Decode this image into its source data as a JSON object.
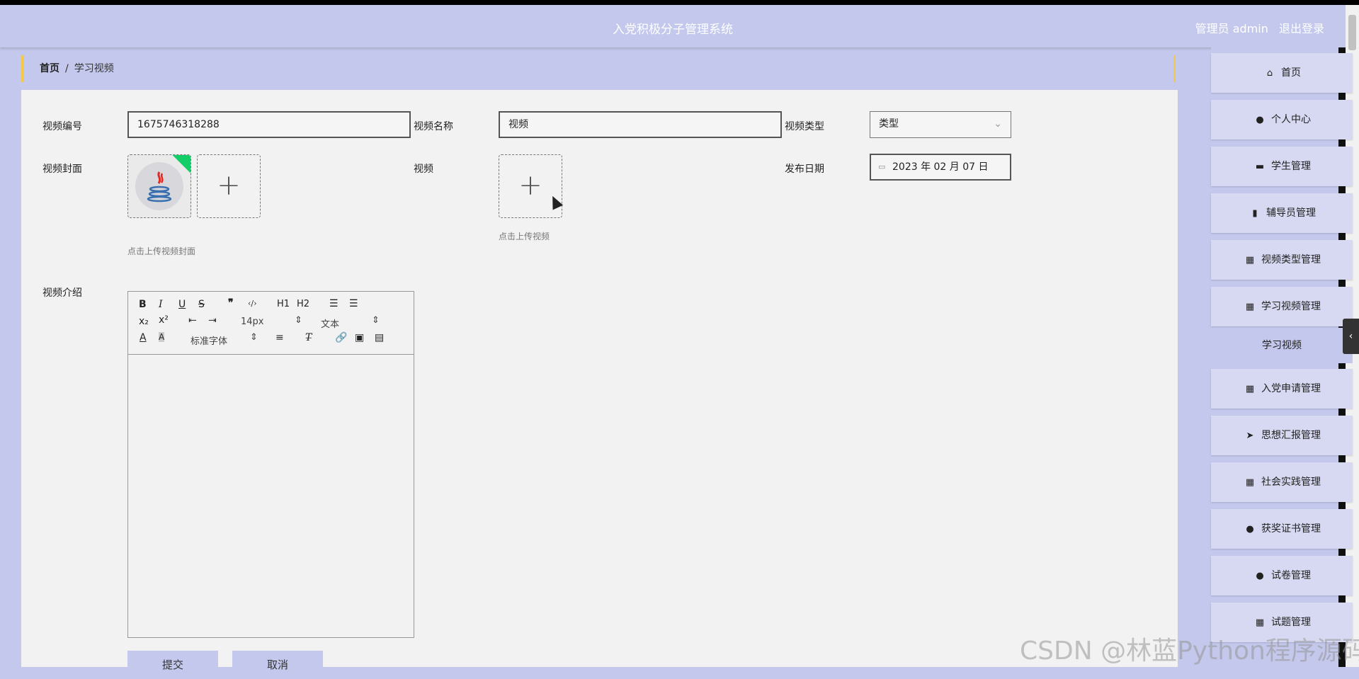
{
  "app": {
    "title": "入党积极分子管理系统"
  },
  "header": {
    "user_role": "管理员 admin",
    "logout": "退出登录"
  },
  "breadcrumb": {
    "home": "首页",
    "separator": "/",
    "current": "学习视频"
  },
  "form": {
    "video_no": {
      "label": "视频编号",
      "value": "1675746318288"
    },
    "video_name": {
      "label": "视频名称",
      "value": "视频"
    },
    "video_type": {
      "label": "视频类型",
      "value": "类型"
    },
    "cover": {
      "label": "视频封面",
      "hint": "点击上传视频封面"
    },
    "video": {
      "label": "视频",
      "hint": "点击上传视频"
    },
    "publish_date": {
      "label": "发布日期",
      "value": "2023 年 02 月 07 日"
    },
    "intro": {
      "label": "视频介绍"
    },
    "submit": "提交",
    "cancel": "取消"
  },
  "editor": {
    "bold": "B",
    "italic": "I",
    "underline": "U",
    "strike": "S",
    "quote": "❞",
    "code": "‹/›",
    "h1": "H1",
    "h2": "H2",
    "sub": "x₂",
    "sup": "x²",
    "size": "14px",
    "header": "文本",
    "font": "标准字体",
    "color": "A",
    "bg": "A"
  },
  "sidebar": {
    "items": [
      {
        "label": "首页",
        "icon": "home-icon"
      },
      {
        "label": "个人中心",
        "icon": "user-icon"
      },
      {
        "label": "学生管理",
        "icon": "ticket-icon"
      },
      {
        "label": "辅导员管理",
        "icon": "clipboard-icon"
      },
      {
        "label": "视频类型管理",
        "icon": "grid-icon"
      },
      {
        "label": "学习视频管理",
        "icon": "grid-icon"
      },
      {
        "label": "入党申请管理",
        "icon": "grid-icon"
      },
      {
        "label": "思想汇报管理",
        "icon": "send-icon"
      },
      {
        "label": "社会实践管理",
        "icon": "grid-icon"
      },
      {
        "label": "获奖证书管理",
        "icon": "user-icon"
      },
      {
        "label": "试卷管理",
        "icon": "user-icon"
      },
      {
        "label": "试题管理",
        "icon": "grid-icon"
      }
    ],
    "active_sub": "学习视频"
  },
  "watermark": "CSDN @林蓝Python程序源码"
}
